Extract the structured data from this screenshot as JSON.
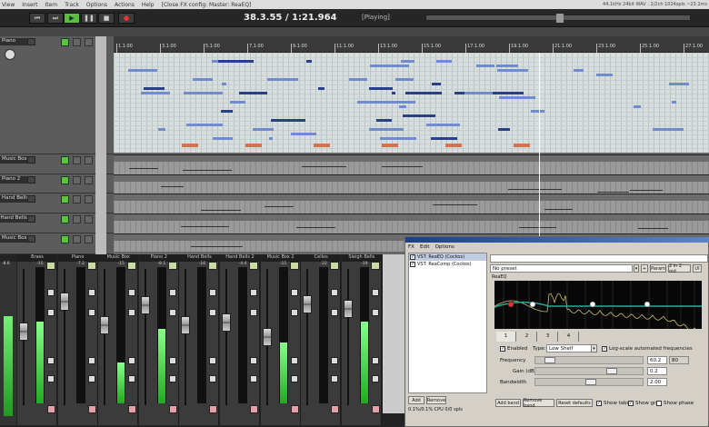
{
  "menubar": {
    "items": [
      "View",
      "Insert",
      "Item",
      "Track",
      "Options",
      "Actions",
      "Help"
    ],
    "title": "[Close FX config: Master: ReaEQ]",
    "status": "44.1kHz 24bit WAV : 2/2ch 1024spls ~23.2ms"
  },
  "transport": {
    "time": "38.3.55 / 1:21.964",
    "state": "[Playing]",
    "buttons": [
      "rewind",
      "fast-forward",
      "play",
      "pause",
      "stop",
      "record"
    ],
    "position_fraction": 0.49
  },
  "ruler": {
    "labels": [
      "1.1.00",
      "3.1.00",
      "5.1.00",
      "7.1.00",
      "9.1.00",
      "11.1.00",
      "13.1.00",
      "15.1.00",
      "17.1.00",
      "19.1.00",
      "21.1.00",
      "23.1.00",
      "25.1.00",
      "27.1.00"
    ]
  },
  "tracks": [
    {
      "name": "Piano"
    },
    {
      "name": "Music Box"
    },
    {
      "name": "Piano 2"
    },
    {
      "name": "Hand Bells"
    },
    {
      "name": "Hand Bells 2"
    },
    {
      "name": "Music Box 2"
    }
  ],
  "mixer": {
    "strips": [
      {
        "name": "Brass",
        "peak": "-15",
        "fader_level": 0.55,
        "meter_level": 0.6
      },
      {
        "name": "Piano",
        "peak": "-7.2",
        "fader_level": 0.8,
        "meter_level": 0.0
      },
      {
        "name": "Music Box",
        "peak": "-15",
        "fader_level": 0.6,
        "meter_level": 0.3
      },
      {
        "name": "Piano 2",
        "peak": "-8.1",
        "fader_level": 0.77,
        "meter_level": 0.55
      },
      {
        "name": "Hand Bells",
        "peak": "-16",
        "fader_level": 0.6,
        "meter_level": 0.0
      },
      {
        "name": "Hand Bells 2",
        "peak": "-4.4",
        "fader_level": 0.62,
        "meter_level": 0.0
      },
      {
        "name": "Music Box 2",
        "peak": "-15",
        "fader_level": 0.5,
        "meter_level": 0.45
      },
      {
        "name": "Cellos",
        "peak": "-22",
        "fader_level": 0.78,
        "meter_level": 0.0
      },
      {
        "name": "Sleigh Bells",
        "peak": "-19",
        "fader_level": 0.74,
        "meter_level": 0.6
      }
    ],
    "master_peak": "-8.6"
  },
  "fx": {
    "menu": [
      "FX",
      "Edit",
      "Options"
    ],
    "chain": [
      {
        "label": "VST: ReaEQ (Cockos)",
        "enabled": true
      },
      {
        "label": "VST: ReaComp (Cockos)",
        "enabled": true
      }
    ],
    "add": "Add",
    "remove": "Remove",
    "cpu": "0.1%/0.1% CPU 0/0 spls",
    "preset": "No preset",
    "plus": "+",
    "param": "Param",
    "io": "2 in 2 out",
    "ui": "UI",
    "plugin_name": "ReaEQ",
    "tabs": [
      "1",
      "2",
      "3",
      "4"
    ],
    "enabled_label": "Enabled",
    "type_label": "Type:",
    "type_value": "Low Shelf",
    "logscale_label": "Log-scale automated frequencies",
    "frequency_label": "Frequency",
    "frequency_value": "60.2",
    "frequency_alt": "80",
    "gain_label": "Gain (dB)",
    "gain_value": "0.2",
    "bandwidth_label": "Bandwidth",
    "bandwidth_value": "2.00",
    "add_band": "Add band",
    "remove_band": "Remove band",
    "reset": "Reset defaults",
    "show_tabs": "Show tabs",
    "show_grid": "Show grid",
    "show_phase": "Show phase",
    "show_tabs_checked": true,
    "show_grid_checked": true,
    "show_phase_checked": false
  },
  "colors": {
    "play": "#58c03a",
    "eq_line": "#2aa89a",
    "eq_spectrum": "#c8c070",
    "band_active": "#e03030"
  }
}
